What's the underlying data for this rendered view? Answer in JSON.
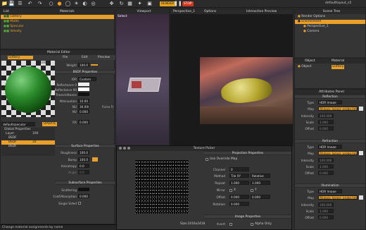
{
  "toolbar": {
    "render_label": "RENDER",
    "stop_label": "STOP",
    "window_title": "defaultlayout_s5"
  },
  "list_panel": {
    "title": "List",
    "materials_title": "Materials",
    "items": [
      {
        "label": "Glittery",
        "selected": true
      },
      {
        "label": "Matte",
        "selected": false
      },
      {
        "label": "Specular",
        "selected": false
      },
      {
        "label": "Velvety",
        "selected": false
      }
    ]
  },
  "viewport": {
    "title": "Viewport",
    "select_label": "Select",
    "camera_tab": "Perspective_1",
    "options_tab": "Options"
  },
  "interactive_preview": {
    "title": "Interactive Preview"
  },
  "scene_tree": {
    "title": "Scene Tree",
    "items": [
      {
        "label": "Render Options",
        "selected": false,
        "indent": 0
      },
      {
        "label": "Environment",
        "selected": true,
        "indent": 0
      },
      {
        "label": "Perspective_1",
        "selected": false,
        "indent": 1
      },
      {
        "label": "Camera",
        "selected": false,
        "indent": 1
      }
    ],
    "col_object": "Object",
    "col_material": "Material",
    "object_name": "Object",
    "object_material": "Glittery"
  },
  "material_editor": {
    "title": "Material Editor",
    "material_name": "Glittery",
    "menu": [
      "File",
      "Edit",
      "Preview"
    ],
    "zoom": "100%",
    "weight_label": "Weight",
    "weight_value": "100.0",
    "bsdf_section": "BSDF Properties",
    "ior_label": "IOR",
    "ior_value": "Custom",
    "reflectance0_label": "Reflectance 0",
    "reflectance90_label": "Reflectance 90",
    "transmittance_label": "Transmittance",
    "attenuation_label": "Attenuation",
    "attenuation_value": "10.00",
    "nu_label": "NU",
    "nu_value": "30.000",
    "force_fr_label": "Force Fr",
    "nv_label": "NV",
    "nv_value": "0.000",
    "rx_label": "RX",
    "rx_value": "0.000",
    "surface_section": "Surface Properties",
    "roughness_label": "Roughness",
    "roughness_value": "100.0",
    "bump_label": "Bump",
    "bump_value": "100.0",
    "anisotropy_label": "Anisotropy",
    "anisotropy_value": "0.0",
    "angle_label": "Angle",
    "angle_value": "0.0",
    "subsurface_section": "Subsurface Properties",
    "scattering_label": "Scattering",
    "coef_label": "Coef/Absorption",
    "coef_value": "0.000",
    "single_sided_label": "Single Sided",
    "status_text": "Change material assignments by name",
    "update_label": "UPDATE",
    "mat_name_field": "defaultspecular",
    "global_props": "Global Properties",
    "layer_label": "Layer",
    "layer_value": "100",
    "layers": [
      {
        "name": "BSDF",
        "value": "",
        "selected": false
      },
      {
        "name": "BSDF",
        "value": "20",
        "selected": true
      },
      {
        "name": "BSDF",
        "value": "",
        "selected": false
      }
    ]
  },
  "attributes_panel": {
    "title": "Attributes Panel",
    "groups": [
      {
        "section": "Reflection",
        "type_label": "Type",
        "type_value": "HDR Image",
        "map_label": "Map",
        "map_value": "Rhinpix_lgrace_probe.hdr",
        "intensity_label": "Intensity",
        "intensity_value": "100.000",
        "scale_label": "Scale",
        "scale_value": "1.000",
        "offset_label": "Offset",
        "offset_value": "0.000"
      },
      {
        "section": "Refraction",
        "type_label": "Type",
        "type_value": "HDR Image",
        "map_label": "Map",
        "map_value": "Rhinpix_lgrace_probe.hdr",
        "intensity_label": "Intensity",
        "intensity_value": "100.000",
        "scale_label": "Scale",
        "scale_value": "1.000",
        "offset_label": "Offset",
        "offset_value": "0.000"
      },
      {
        "section": "Illumination",
        "type_label": "Type",
        "type_value": "HDR Image",
        "map_label": "Map",
        "map_value": "Rhinpix_lgrace_probe.hdr",
        "intensity_label": "Intensity",
        "intensity_value": "100.000",
        "scale_label": "Scale",
        "scale_value": "1.000",
        "offset_label": "Offset",
        "offset_value": "0.000"
      }
    ]
  },
  "texture_picker": {
    "title": "Texture Picker",
    "projection_section": "Projection Properties",
    "use_override": "Use Override Map",
    "channel_label": "Channel",
    "channel_value": "0",
    "method_label": "Method",
    "method_value": "Tile XY",
    "relative_value": "Relative",
    "repeat_label": "Repeat",
    "repeat_x": "1.000",
    "repeat_y": "1.000",
    "mirror_label": "Mirror",
    "mirror_x": "X",
    "mirror_y": "Y",
    "offset_label": "Offset",
    "offset_x": "0.000",
    "offset_y": "0.000",
    "rotation_label": "Rotation",
    "rotation_value": "0.000",
    "image_section": "Image Properties",
    "invert_label": "Invert",
    "alpha_only": "Alpha Only",
    "size_text": "Size:2416x2416"
  },
  "colors": {
    "accent": "#e8a02a",
    "render_btn": "#e6a21c",
    "stop_btn": "#d2341e",
    "panel_bg": "#353535",
    "selection": "#e8a02a"
  }
}
